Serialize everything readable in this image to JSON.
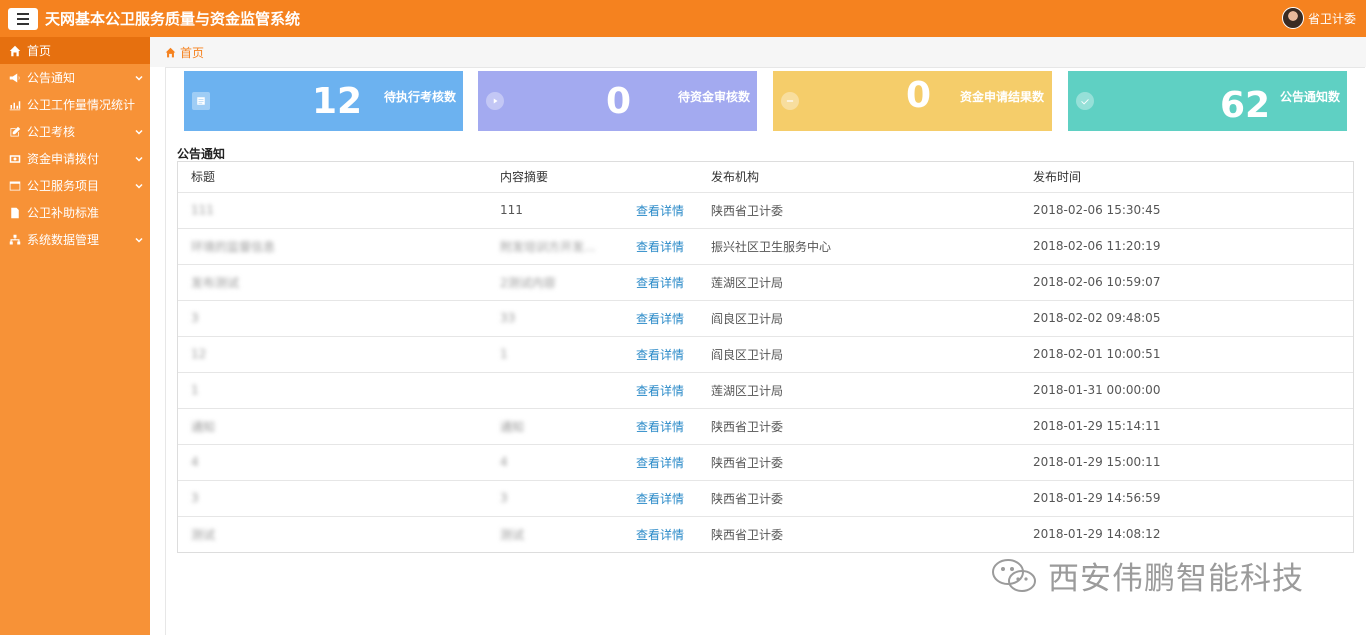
{
  "header": {
    "title": "天网基本公卫服务质量与资金监管系统",
    "user_name": "省卫计委"
  },
  "sidebar": {
    "items": [
      {
        "label": "首页",
        "icon": "home-icon",
        "active": true,
        "expandable": false
      },
      {
        "label": "公告通知",
        "icon": "megaphone-icon",
        "active": false,
        "expandable": true
      },
      {
        "label": "公卫工作量情况统计",
        "icon": "bar-chart-icon",
        "active": false,
        "expandable": false
      },
      {
        "label": "公卫考核",
        "icon": "edit-icon",
        "active": false,
        "expandable": true
      },
      {
        "label": "资金申请拨付",
        "icon": "money-icon",
        "active": false,
        "expandable": true
      },
      {
        "label": "公卫服务项目",
        "icon": "window-icon",
        "active": false,
        "expandable": true
      },
      {
        "label": "公卫补助标准",
        "icon": "file-icon",
        "active": false,
        "expandable": false
      },
      {
        "label": "系统数据管理",
        "icon": "sitemap-icon",
        "active": false,
        "expandable": true
      }
    ]
  },
  "breadcrumb": {
    "label": "首页",
    "icon": "home-icon"
  },
  "cards": [
    {
      "value": "12",
      "label": "待执行考核数",
      "color": "#6cb2f0",
      "icon": "list-icon"
    },
    {
      "value": "0",
      "label": "待资金审核数",
      "color": "#a3aaf0",
      "icon": "play-circle-icon"
    },
    {
      "value": "0",
      "label": "资金申请结果数",
      "color": "#f5cd6a",
      "icon": "minus-circle-icon"
    },
    {
      "value": "62",
      "label": "公告通知数",
      "color": "#5fd0c3",
      "icon": "check-circle-icon"
    }
  ],
  "notices": {
    "section_title": "公告通知",
    "columns": [
      "标题",
      "内容摘要",
      "",
      "发布机构",
      "发布时间"
    ],
    "detail_label": "查看详情",
    "rows": [
      {
        "title": "111",
        "summary": "111",
        "org": "陕西省卫计委",
        "time": "2018-02-06 15:30:45"
      },
      {
        "title": "环境的监督信息",
        "summary": "附发培训方开发...",
        "org": "振兴社区卫生服务中心",
        "time": "2018-02-06 11:20:19"
      },
      {
        "title": "发布测试",
        "summary": "2测试内容",
        "org": "莲湖区卫计局",
        "time": "2018-02-06 10:59:07"
      },
      {
        "title": "3",
        "summary": "33",
        "org": "阎良区卫计局",
        "time": "2018-02-02 09:48:05"
      },
      {
        "title": "12",
        "summary": "1",
        "org": "阎良区卫计局",
        "time": "2018-02-01 10:00:51"
      },
      {
        "title": "1",
        "summary": "",
        "org": "莲湖区卫计局",
        "time": "2018-01-31 00:00:00"
      },
      {
        "title": "通知",
        "summary": "通知",
        "org": "陕西省卫计委",
        "time": "2018-01-29 15:14:11"
      },
      {
        "title": "4",
        "summary": "4",
        "org": "陕西省卫计委",
        "time": "2018-01-29 15:00:11"
      },
      {
        "title": "3",
        "summary": "3",
        "org": "陕西省卫计委",
        "time": "2018-01-29 14:56:59"
      },
      {
        "title": "测试",
        "summary": "测试",
        "org": "陕西省卫计委",
        "time": "2018-01-29 14:08:12"
      }
    ]
  },
  "watermark": {
    "text": "西安伟鹏智能科技",
    "icon": "wechat-icon"
  }
}
